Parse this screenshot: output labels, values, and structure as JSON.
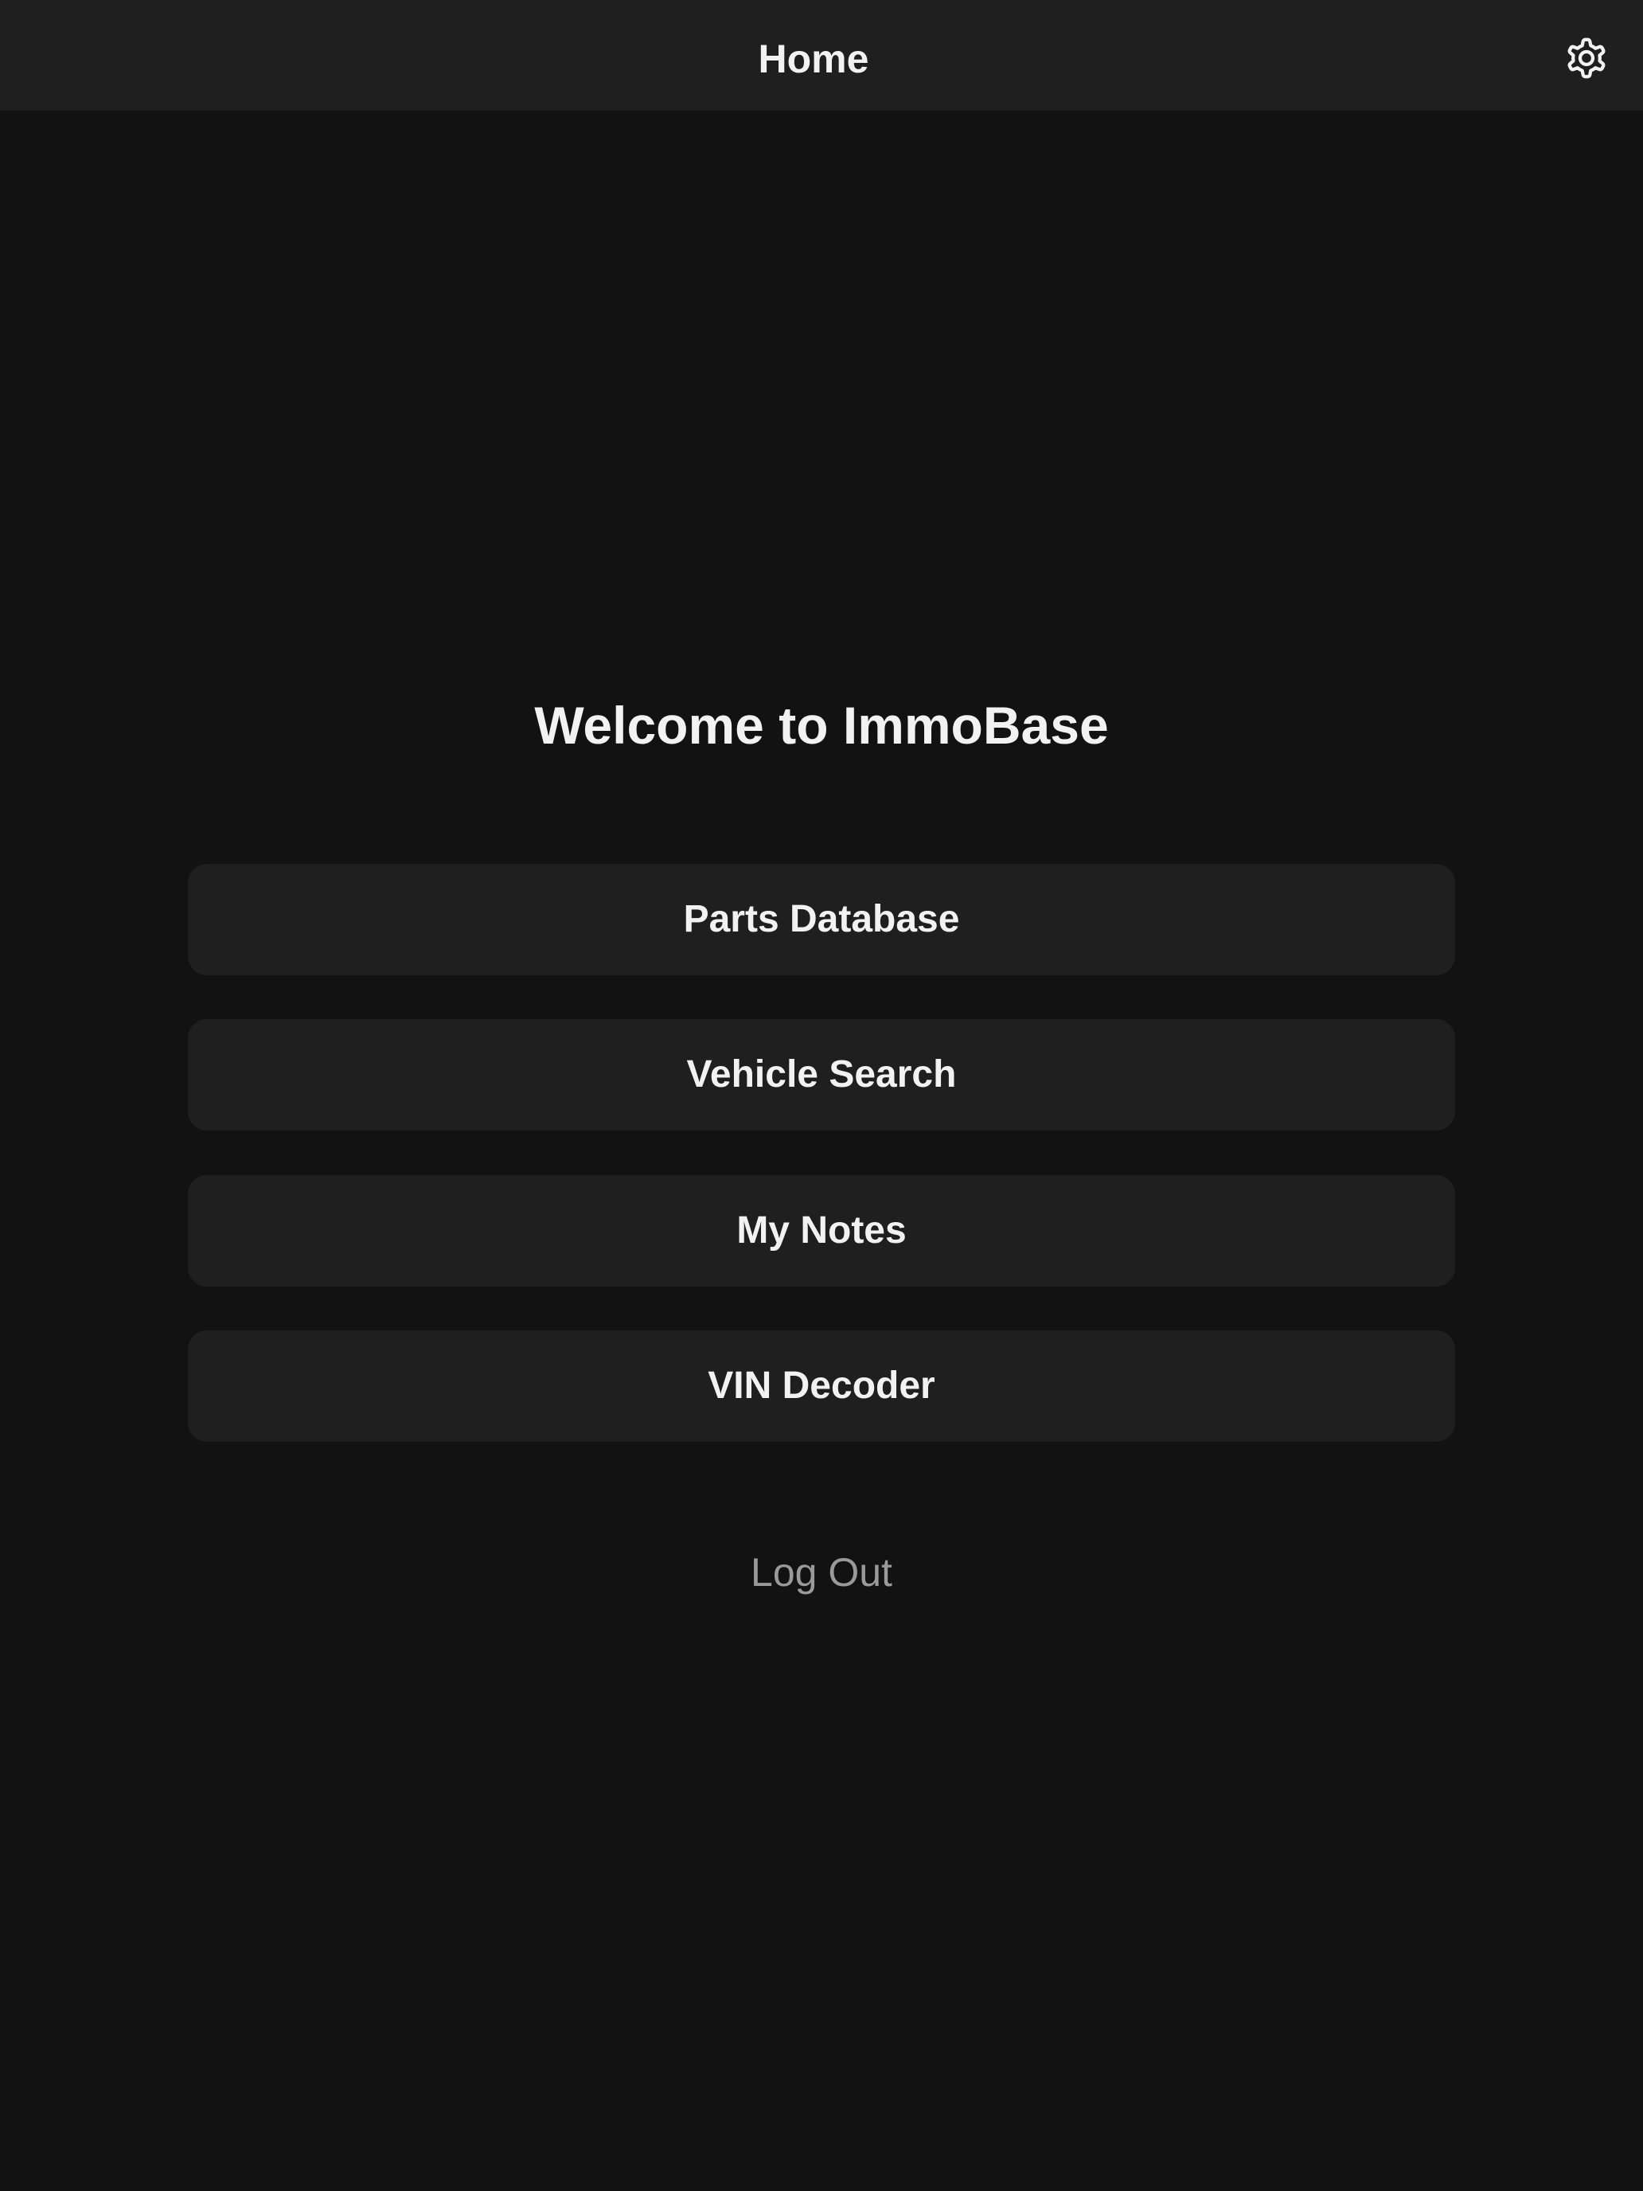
{
  "navbar": {
    "title": "Home",
    "settings_icon": "gear-icon"
  },
  "main": {
    "welcome": "Welcome to ImmoBase",
    "menu_items": [
      {
        "label": "Parts Database"
      },
      {
        "label": "Vehicle Search"
      },
      {
        "label": "My Notes"
      },
      {
        "label": "VIN Decoder"
      }
    ],
    "logout_label": "Log Out"
  },
  "colors": {
    "background": "#121212",
    "surface": "#1f1f1f",
    "text_primary": "#f2f2f2",
    "text_secondary": "#9a9a9a"
  }
}
